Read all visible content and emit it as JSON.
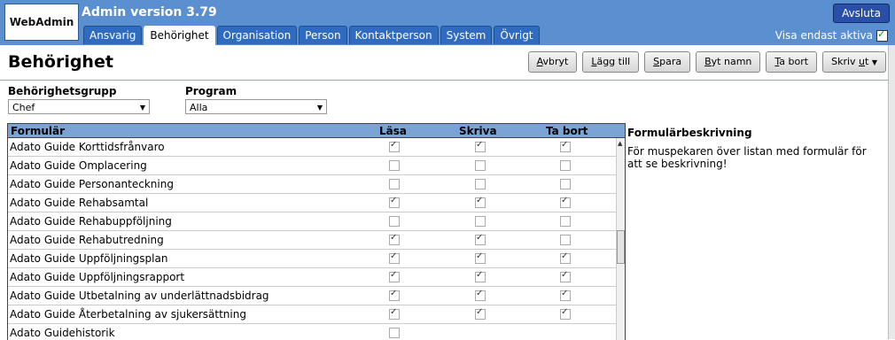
{
  "header": {
    "logo_text": "WebAdmin",
    "version": "Admin version 3.79",
    "exit_label": "Avsluta",
    "only_active_label": "Visa endast aktiva",
    "tabs": [
      {
        "label": "Ansvarig",
        "active": false
      },
      {
        "label": "Behörighet",
        "active": true
      },
      {
        "label": "Organisation",
        "active": false
      },
      {
        "label": "Person",
        "active": false
      },
      {
        "label": "Kontaktperson",
        "active": false
      },
      {
        "label": "System",
        "active": false
      },
      {
        "label": "Övrigt",
        "active": false
      }
    ]
  },
  "page": {
    "title": "Behörighet",
    "buttons": {
      "avbryt": {
        "ul": "A",
        "rest": "vbryt"
      },
      "lagg_till": {
        "ul": "L",
        "rest": "ägg till"
      },
      "spara": {
        "ul": "S",
        "rest": "para"
      },
      "byt_namn": {
        "ul": "B",
        "rest": "yt namn"
      },
      "ta_bort": {
        "ul": "T",
        "rest": "a bort"
      },
      "skriv_ut": {
        "pre": "Skriv ",
        "ul": "u",
        "rest": "t"
      }
    }
  },
  "filters": {
    "group_label": "Behörighetsgrupp",
    "group_value": "Chef",
    "program_label": "Program",
    "program_value": "Alla"
  },
  "grid": {
    "headers": {
      "form": "Formulär",
      "read": "Läsa",
      "write": "Skriva",
      "delete": "Ta bort"
    },
    "rows": [
      {
        "name": "Adato Guide Korttidsfrånvaro",
        "read": true,
        "write": true,
        "delete": true
      },
      {
        "name": "Adato Guide Omplacering",
        "read": false,
        "write": false,
        "delete": false
      },
      {
        "name": "Adato Guide Personanteckning",
        "read": false,
        "write": false,
        "delete": false
      },
      {
        "name": "Adato Guide Rehabsamtal",
        "read": true,
        "write": true,
        "delete": true
      },
      {
        "name": "Adato Guide Rehabuppföljning",
        "read": false,
        "write": false,
        "delete": false
      },
      {
        "name": "Adato Guide Rehabutredning",
        "read": true,
        "write": true,
        "delete": false
      },
      {
        "name": "Adato Guide Uppföljningsplan",
        "read": true,
        "write": true,
        "delete": true
      },
      {
        "name": "Adato Guide Uppföljningsrapport",
        "read": true,
        "write": true,
        "delete": true
      },
      {
        "name": "Adato Guide Utbetalning av underlättnadsbidrag",
        "read": true,
        "write": true,
        "delete": true
      },
      {
        "name": "Adato Guide Återbetalning av sjukersättning",
        "read": true,
        "write": true,
        "delete": true
      },
      {
        "name": "Adato Guidehistorik",
        "read": false,
        "write": null,
        "delete": null
      }
    ]
  },
  "description": {
    "title": "Formulärbeskrivning",
    "text": "För muspekaren över listan med formulär för att se beskrivning!"
  },
  "colors": {
    "header_bg": "#5a8fd0",
    "tab_bg": "#2f6cc0",
    "grid_header_bg": "#7ba3d6",
    "exit_button_bg": "#2a4fa8"
  }
}
